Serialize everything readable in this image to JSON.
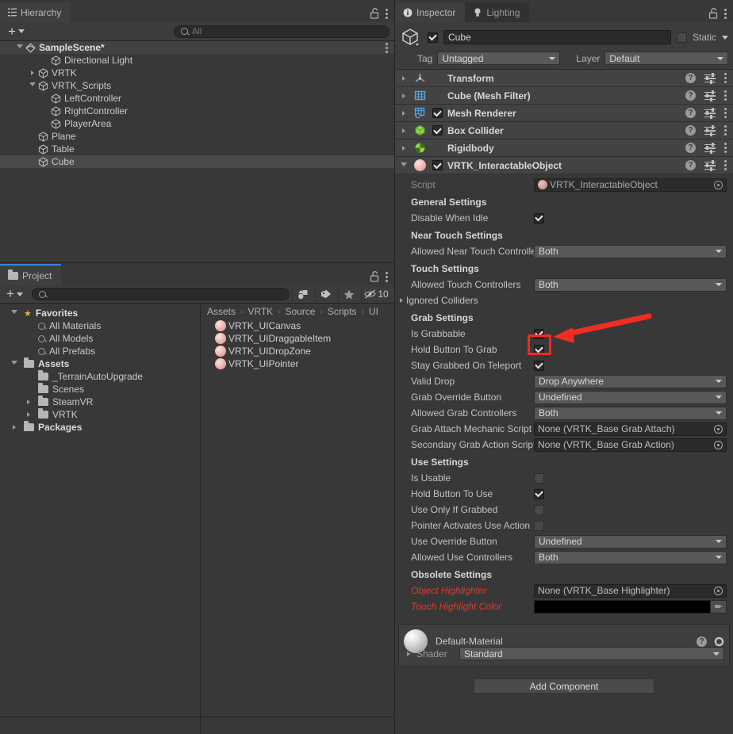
{
  "hierarchy": {
    "tab_label": "Hierarchy",
    "tab_icon": "hierarchy-icon",
    "lock_icon": "lock-open-icon",
    "menu_icon": "kebab-menu-icon",
    "create_label": "+",
    "search_placeholder": "All",
    "search_value": "",
    "items": [
      {
        "label": "SampleScene*",
        "depth": 0,
        "expanded": true,
        "type": "scene",
        "selected": false
      },
      {
        "label": "Directional Light",
        "depth": 2,
        "expanded": null,
        "type": "gameobject",
        "selected": false
      },
      {
        "label": "VRTK",
        "depth": 1,
        "expanded": false,
        "type": "gameobject",
        "selected": false
      },
      {
        "label": "VRTK_Scripts",
        "depth": 1,
        "expanded": true,
        "type": "gameobject",
        "selected": false
      },
      {
        "label": "LeftController",
        "depth": 2,
        "expanded": null,
        "type": "gameobject",
        "selected": false
      },
      {
        "label": "RightController",
        "depth": 2,
        "expanded": null,
        "type": "gameobject",
        "selected": false
      },
      {
        "label": "PlayerArea",
        "depth": 2,
        "expanded": null,
        "type": "gameobject",
        "selected": false
      },
      {
        "label": "Plane",
        "depth": 1,
        "expanded": null,
        "type": "gameobject",
        "selected": false
      },
      {
        "label": "Table",
        "depth": 1,
        "expanded": null,
        "type": "gameobject",
        "selected": false
      },
      {
        "label": "Cube",
        "depth": 1,
        "expanded": null,
        "type": "gameobject",
        "selected": true
      }
    ]
  },
  "project": {
    "tab_label": "Project",
    "tab_icon": "folder-icon",
    "lock_icon": "lock-open-icon",
    "menu_icon": "kebab-menu-icon",
    "create_label": "+",
    "search_placeholder": "",
    "search_value": "",
    "toolbar_icons": [
      "asset-type-filter-icon",
      "label-filter-icon",
      "favorite-star-icon",
      "hidden-packages-icon"
    ],
    "hidden_count": "10",
    "tree": [
      {
        "label": "Favorites",
        "depth": 0,
        "expanded": true,
        "icon": "star-icon"
      },
      {
        "label": "All Materials",
        "depth": 1,
        "expanded": null,
        "icon": "search-icon"
      },
      {
        "label": "All Models",
        "depth": 1,
        "expanded": null,
        "icon": "search-icon"
      },
      {
        "label": "All Prefabs",
        "depth": 1,
        "expanded": null,
        "icon": "search-icon"
      },
      {
        "label": "Assets",
        "depth": 0,
        "expanded": true,
        "icon": "folder-open-icon"
      },
      {
        "label": "_TerrainAutoUpgrade",
        "depth": 1,
        "expanded": null,
        "icon": "folder-icon"
      },
      {
        "label": "Scenes",
        "depth": 1,
        "expanded": null,
        "icon": "folder-icon"
      },
      {
        "label": "SteamVR",
        "depth": 1,
        "expanded": false,
        "icon": "folder-icon"
      },
      {
        "label": "VRTK",
        "depth": 1,
        "expanded": false,
        "icon": "folder-icon"
      },
      {
        "label": "Packages",
        "depth": 0,
        "expanded": false,
        "icon": "folder-icon"
      }
    ],
    "breadcrumb": [
      "Assets",
      "VRTK",
      "Source",
      "Scripts",
      "UI"
    ],
    "files": [
      {
        "label": "VRTK_UICanvas",
        "icon": "script-icon"
      },
      {
        "label": "VRTK_UIDraggableItem",
        "icon": "script-icon"
      },
      {
        "label": "VRTK_UIDropZone",
        "icon": "script-icon"
      },
      {
        "label": "VRTK_UIPointer",
        "icon": "script-icon"
      }
    ]
  },
  "inspector": {
    "tabs": [
      {
        "label": "Inspector",
        "icon": "info-icon",
        "active": true
      },
      {
        "label": "Lighting",
        "icon": "lightbulb-icon",
        "active": false
      }
    ],
    "lock_icon": "lock-open-icon",
    "menu_icon": "kebab-menu-icon",
    "gameobject": {
      "icon": "cube-gameobject-icon",
      "enabled": true,
      "name": "Cube",
      "static_label": "Static",
      "static_checked": false,
      "tag_label": "Tag",
      "tag_value": "Untagged",
      "layer_label": "Layer",
      "layer_value": "Default"
    },
    "components": [
      {
        "title": "Transform",
        "icon": "transform-icon",
        "expanded": false,
        "has_enable_checkbox": false,
        "enabled": false
      },
      {
        "title": "Cube (Mesh Filter)",
        "icon": "mesh-filter-icon",
        "expanded": false,
        "has_enable_checkbox": false,
        "enabled": false
      },
      {
        "title": "Mesh Renderer",
        "icon": "mesh-renderer-icon",
        "expanded": false,
        "has_enable_checkbox": true,
        "enabled": true
      },
      {
        "title": "Box Collider",
        "icon": "box-collider-icon",
        "expanded": false,
        "has_enable_checkbox": true,
        "enabled": true
      },
      {
        "title": "Rigidbody",
        "icon": "rigidbody-icon",
        "expanded": false,
        "has_enable_checkbox": false,
        "enabled": false
      },
      {
        "title": "VRTK_InteractableObject",
        "icon": "script-icon",
        "expanded": true,
        "has_enable_checkbox": true,
        "enabled": true
      }
    ],
    "row_icons": {
      "help": "help-icon",
      "preset": "preset-sliders-icon",
      "menu": "kebab-menu-icon"
    },
    "script_row": {
      "label": "Script",
      "value": "VRTK_InteractableObject",
      "icon": "script-icon"
    },
    "sections": [
      {
        "heading": "General Settings",
        "rows": [
          {
            "label": "Disable When Idle",
            "kind": "checkbox",
            "value": true
          }
        ]
      },
      {
        "heading": "Near Touch Settings",
        "rows": [
          {
            "label": "Allowed Near Touch Controllers",
            "kind": "dropdown",
            "value": "Both"
          }
        ]
      },
      {
        "heading": "Touch Settings",
        "rows": [
          {
            "label": "Allowed Touch Controllers",
            "kind": "dropdown",
            "value": "Both"
          },
          {
            "label": "Ignored Colliders",
            "kind": "foldout",
            "value": ""
          }
        ]
      },
      {
        "heading": "Grab Settings",
        "rows": [
          {
            "label": "Is Grabbable",
            "kind": "checkbox",
            "value": true,
            "highlighted": true
          },
          {
            "label": "Hold Button To Grab",
            "kind": "checkbox",
            "value": true
          },
          {
            "label": "Stay Grabbed On Teleport",
            "kind": "checkbox",
            "value": true
          },
          {
            "label": "Valid Drop",
            "kind": "dropdown",
            "value": "Drop Anywhere"
          },
          {
            "label": "Grab Override Button",
            "kind": "dropdown",
            "value": "Undefined"
          },
          {
            "label": "Allowed Grab Controllers",
            "kind": "dropdown",
            "value": "Both"
          },
          {
            "label": "Grab Attach Mechanic Script",
            "kind": "object",
            "value": "None (VRTK_Base Grab Attach)"
          },
          {
            "label": "Secondary Grab Action Script",
            "kind": "object",
            "value": "None (VRTK_Base Grab Action)"
          }
        ]
      },
      {
        "heading": "Use Settings",
        "rows": [
          {
            "label": "Is Usable",
            "kind": "checkbox",
            "value": false
          },
          {
            "label": "Hold Button To Use",
            "kind": "checkbox",
            "value": true
          },
          {
            "label": "Use Only If Grabbed",
            "kind": "checkbox",
            "value": false
          },
          {
            "label": "Pointer Activates Use Action",
            "kind": "checkbox",
            "value": false
          },
          {
            "label": "Use Override Button",
            "kind": "dropdown",
            "value": "Undefined"
          },
          {
            "label": "Allowed Use Controllers",
            "kind": "dropdown",
            "value": "Both"
          }
        ]
      },
      {
        "heading": "Obsolete Settings",
        "rows": [
          {
            "label": "Object Highlighter",
            "kind": "object",
            "value": "None (VRTK_Base Highlighter)",
            "obsolete": true
          },
          {
            "label": "Touch Highlight Color",
            "kind": "color",
            "value": "#000000",
            "obsolete": true
          }
        ]
      }
    ],
    "material": {
      "name": "Default-Material",
      "shader_label": "Shader",
      "shader_value": "Standard",
      "help_icon": "help-icon",
      "gear_icon": "gear-icon",
      "preview_icon": "material-sphere-icon"
    },
    "add_component_label": "Add Component"
  },
  "annotation": {
    "arrow_color": "#ef2d23",
    "highlight_color": "#ef2d23",
    "target": "Is Grabbable checkbox"
  }
}
